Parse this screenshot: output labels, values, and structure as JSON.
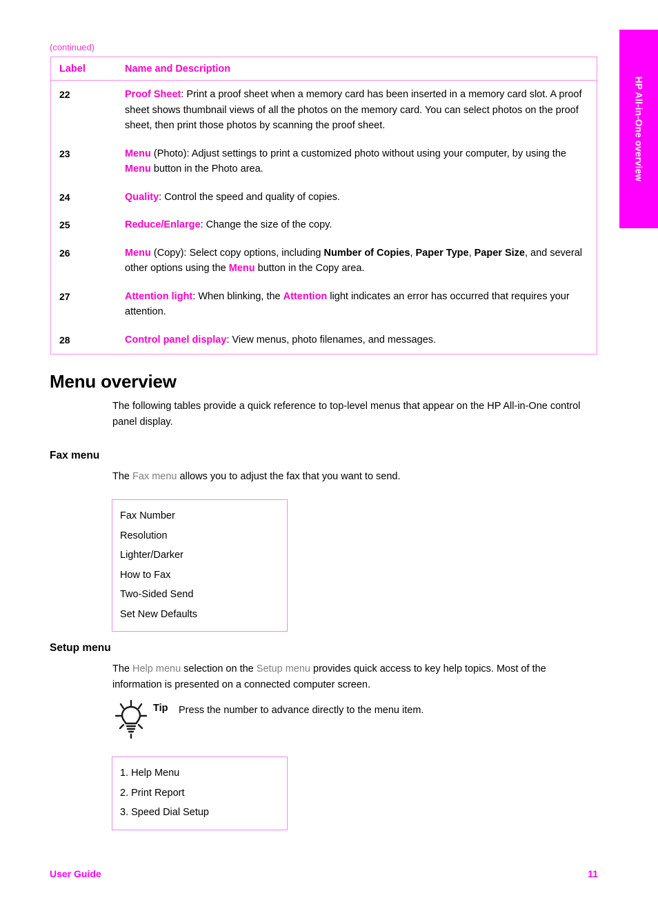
{
  "chapter_tab": {
    "label": "HP All-in-One overview",
    "background_color": "#ff00ff",
    "text_color": "#ffffff"
  },
  "colors": {
    "magenta": "#ff00ff",
    "table_accent": "#ff00cc",
    "table_border": "#ff8ae6",
    "gray_ui_term": "#808080"
  },
  "table": {
    "continued_note": "(continued)",
    "headers": {
      "label": "Label",
      "description": "Name and Description"
    },
    "rows": [
      {
        "label": "22",
        "term": "Proof Sheet",
        "description": ": Print a proof sheet when a memory card has been inserted in a memory card slot. A proof sheet shows thumbnail views of all the photos on the memory card. You can select photos on the proof sheet, then print those photos by scanning the proof sheet."
      },
      {
        "label": "23",
        "term": "Menu",
        "description": " (Photo): Adjust settings to print a customized photo without using your computer, by using the ",
        "term2": "Menu",
        "description2": " button in the Photo area."
      },
      {
        "label": "24",
        "term": "Quality",
        "description": ": Control the speed and quality of copies."
      },
      {
        "label": "25",
        "term": "Reduce/Enlarge",
        "description": ": Change the size of the copy."
      },
      {
        "label": "26",
        "term": "Menu",
        "description": " (Copy): Select copy options, including ",
        "bold1": "Number of Copies",
        "mid1": ", ",
        "bold2": "Paper Type",
        "mid2": ", ",
        "bold3": "Paper Size",
        "mid3": ", and several other options using the ",
        "term2": "Menu",
        "description2": " button in the Copy area."
      },
      {
        "label": "27",
        "term": "Attention light",
        "description": ": When blinking, the ",
        "term2": "Attention",
        "description2": " light indicates an error has occurred that requires your attention."
      },
      {
        "label": "28",
        "term": "Control panel display",
        "description": ": View menus, photo filenames, and messages."
      }
    ]
  },
  "menu_overview": {
    "heading": "Menu overview",
    "intro": "The following tables provide a quick reference to top-level menus that appear on the HP All-in-One control panel display."
  },
  "fax_menu": {
    "heading": "Fax menu",
    "intro_before": "The ",
    "intro_term": "Fax menu",
    "intro_after": " allows you to adjust the fax that you want to send.",
    "items": [
      "Fax Number",
      "Resolution",
      "Lighter/Darker",
      "How to Fax",
      "Two-Sided Send",
      "Set New Defaults"
    ]
  },
  "setup_menu": {
    "heading": "Setup menu",
    "intro_before": "The ",
    "intro_term1": "Help menu",
    "intro_mid": " selection on the ",
    "intro_term2": "Setup menu",
    "intro_after": " provides quick access to key help topics. Most of the information is presented on a connected computer screen.",
    "tip_label": "Tip",
    "tip_text": "Press the number to advance directly to the menu item.",
    "items": [
      "1. Help Menu",
      "2. Print Report",
      "3. Speed Dial Setup"
    ]
  },
  "footer": {
    "left": "User Guide",
    "page_number": "11"
  }
}
